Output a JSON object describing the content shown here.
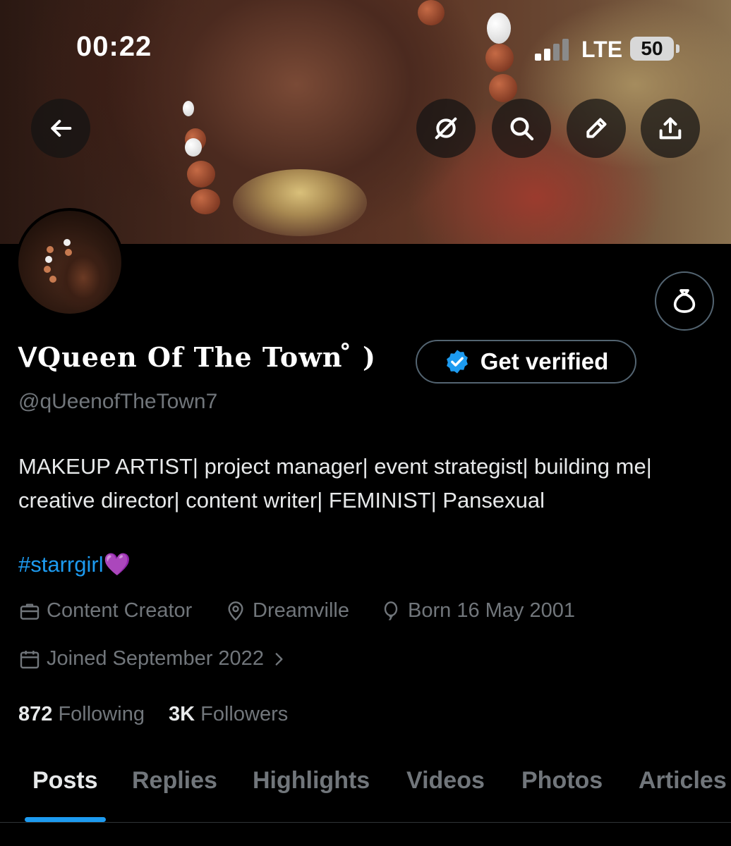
{
  "status_bar": {
    "time": "00:22",
    "network": "LTE",
    "battery": "50"
  },
  "banner": {
    "icons": [
      "back-arrow-icon",
      "grok-icon",
      "search-icon",
      "edit-pencil-icon",
      "share-icon"
    ]
  },
  "profile": {
    "display_name": "ᐯQueen Of The Town ̊ )",
    "handle": "@qUeenofTheTown7",
    "bio": "MAKEUP ARTIST| project manager| event strategist| building me| creative director| content writer| FEMINIST| Pansexual",
    "hashtag": "#starrgirl",
    "heart": "💜",
    "category": "Content Creator",
    "location": "Dreamville",
    "birthday": "Born 16 May 2001",
    "joined": "Joined September 2022",
    "following_count": "872",
    "following_label": "Following",
    "followers_count": "3K",
    "followers_label": "Followers"
  },
  "buttons": {
    "get_verified": "Get verified"
  },
  "tabs": [
    {
      "label": "Posts",
      "active": true
    },
    {
      "label": "Replies",
      "active": false
    },
    {
      "label": "Highlights",
      "active": false
    },
    {
      "label": "Videos",
      "active": false
    },
    {
      "label": "Photos",
      "active": false
    },
    {
      "label": "Articles",
      "active": false
    }
  ],
  "colors": {
    "accent": "#1d9bf0",
    "muted_text": "#71767b",
    "background": "#000000"
  }
}
